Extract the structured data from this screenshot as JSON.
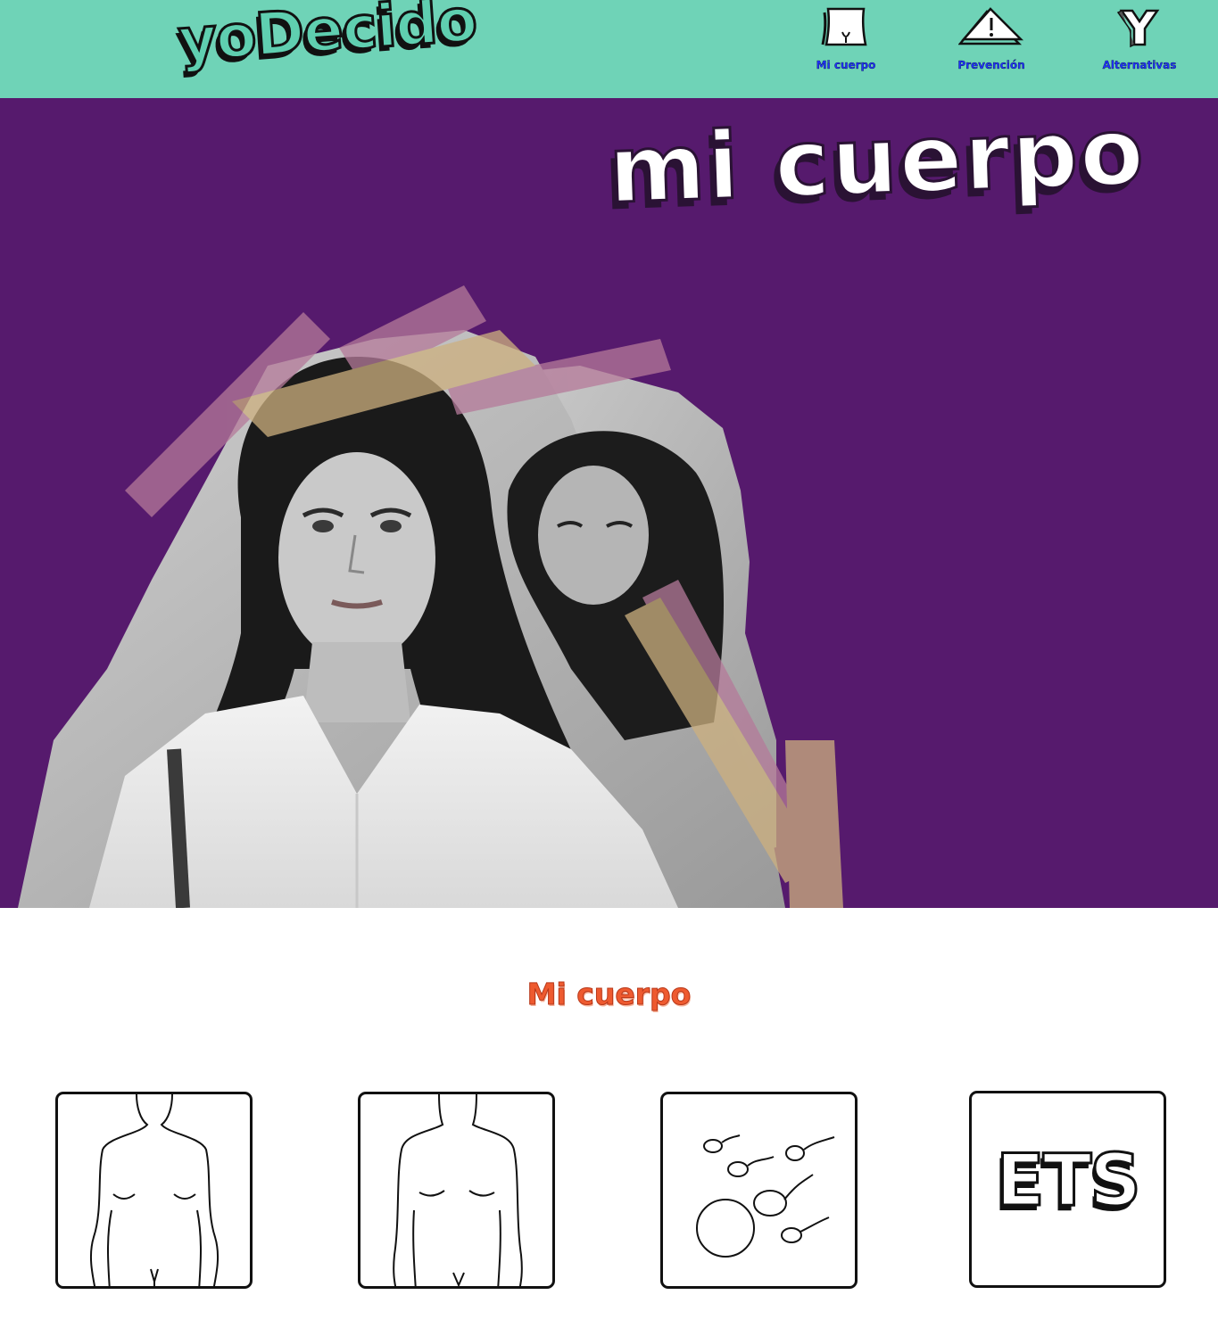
{
  "header": {
    "logo": "yoDecido",
    "nav": [
      {
        "label": "Mi cuerpo",
        "icon": "body-icon"
      },
      {
        "label": "Prevención",
        "icon": "warning-icon"
      },
      {
        "label": "Alternativas",
        "icon": "fork-icon"
      }
    ]
  },
  "hero": {
    "title": "mi cuerpo",
    "photo": "two-women-photo-collage"
  },
  "section": {
    "title": "Mi cuerpo",
    "cards": [
      {
        "icon": "female-body-icon"
      },
      {
        "icon": "male-body-icon"
      },
      {
        "icon": "reproduction-icon"
      },
      {
        "icon": "ets-icon",
        "label": "ETS"
      }
    ]
  },
  "colors": {
    "header_bg": "#6fd3b7",
    "hero_bg": "#561a6d",
    "section_title": "#ee5a2f",
    "nav_text": "#2033ff"
  }
}
